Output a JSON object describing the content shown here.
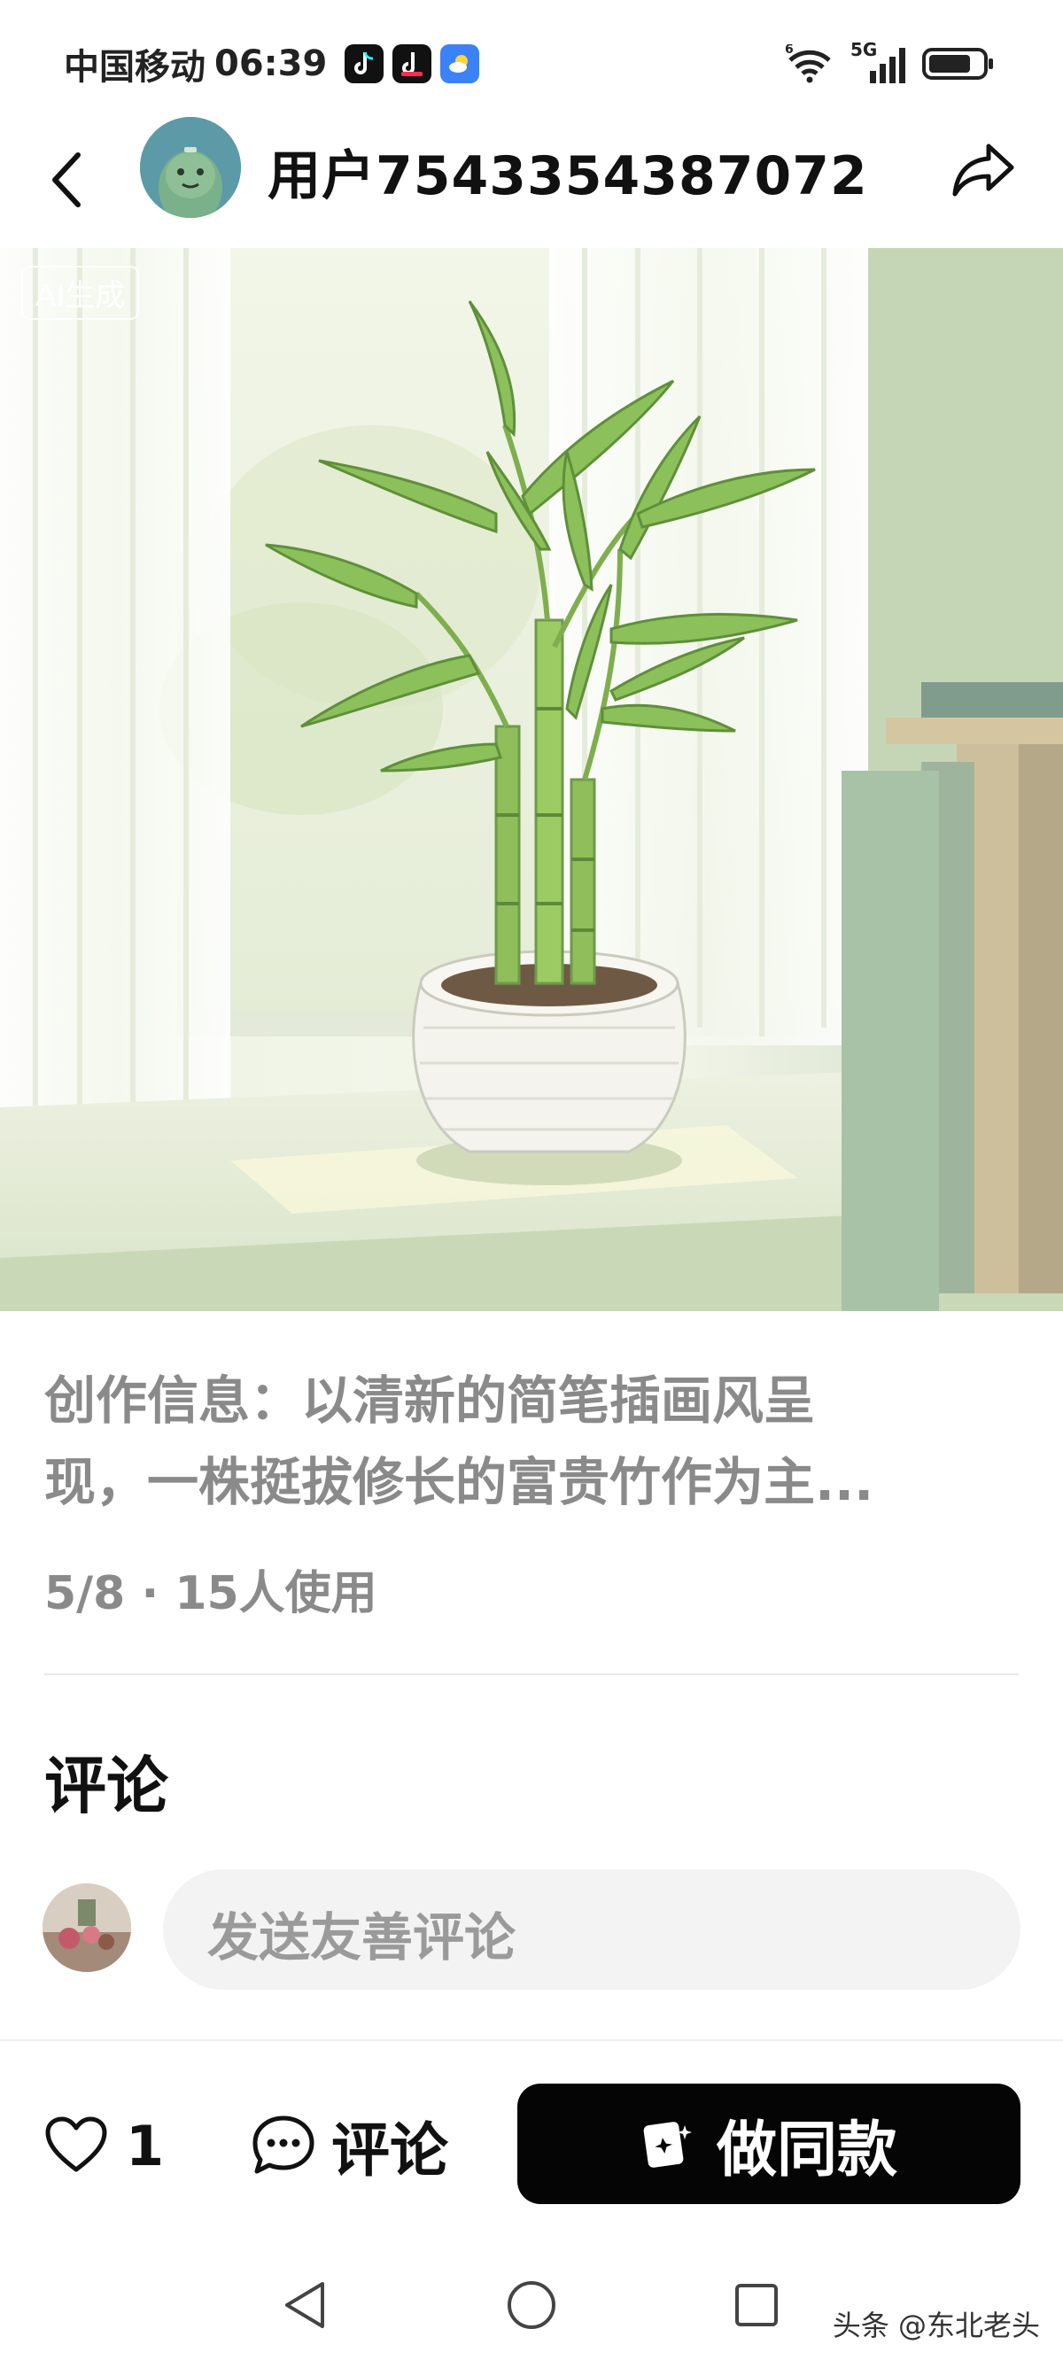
{
  "status_bar": {
    "carrier": "中国移动",
    "time": "06:39",
    "signal_icons": [
      "wifi-6-icon",
      "5g-signal-icon",
      "battery-icon"
    ],
    "network_label": "5G"
  },
  "header": {
    "username": "用户7543354387072"
  },
  "hero": {
    "ai_badge": "AI生成"
  },
  "info": {
    "description_line1": "创作信息：以清新的简笔插画风呈",
    "description_line2": "现，一株挺拔修长的富贵竹作为主...",
    "meta": "5/8 · 15人使用"
  },
  "comments": {
    "title": "评论",
    "input_placeholder": "发送友善评论"
  },
  "bottom_bar": {
    "like_count": "1",
    "comment_label": "评论",
    "make_same_label": "做同款"
  },
  "watermark": "头条 @东北老头",
  "colors": {
    "accent_black": "#050505",
    "muted_text": "#8a8a8a",
    "input_bg": "#f3f3f3"
  }
}
